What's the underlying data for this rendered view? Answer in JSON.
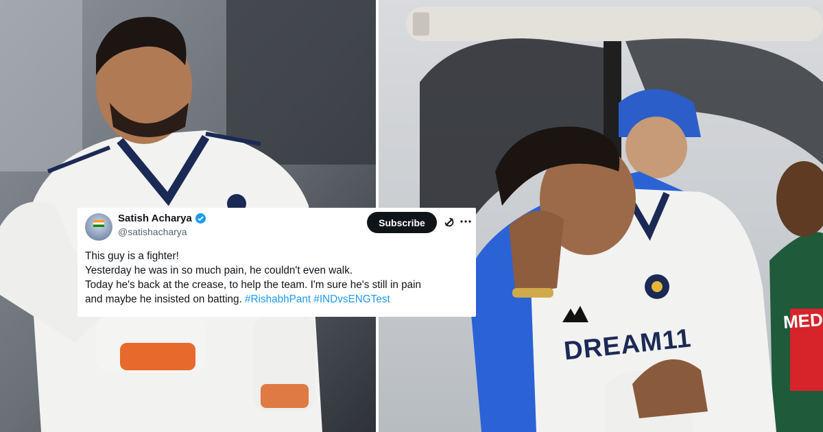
{
  "tweet": {
    "author_name": "Satish Acharya",
    "handle": "@satishacharya",
    "subscribe_label": "Subscribe",
    "lines": [
      "This guy is a fighter!",
      "Yesterday he was in so much pain, he couldn't even walk.",
      "Today he's back at the crease, to help the team. I'm sure he's still in pain",
      "and maybe he insisted on batting."
    ],
    "hashtags": [
      "#RishabhPant",
      "#INDvsENGTest"
    ]
  },
  "photos": {
    "right_jersey_text": "DREAM11",
    "right_medic_text": "MEDIC"
  },
  "icons": {
    "verified": "verified-badge-icon",
    "grok": "grok-icon",
    "more": "more-options-icon"
  },
  "colors": {
    "hashtag": "#1d9bf0",
    "subscribe_bg": "#0f1419",
    "verified": "#1d9bf0",
    "jersey": "#f2f2f0",
    "jersey_navy": "#1b2a55"
  }
}
